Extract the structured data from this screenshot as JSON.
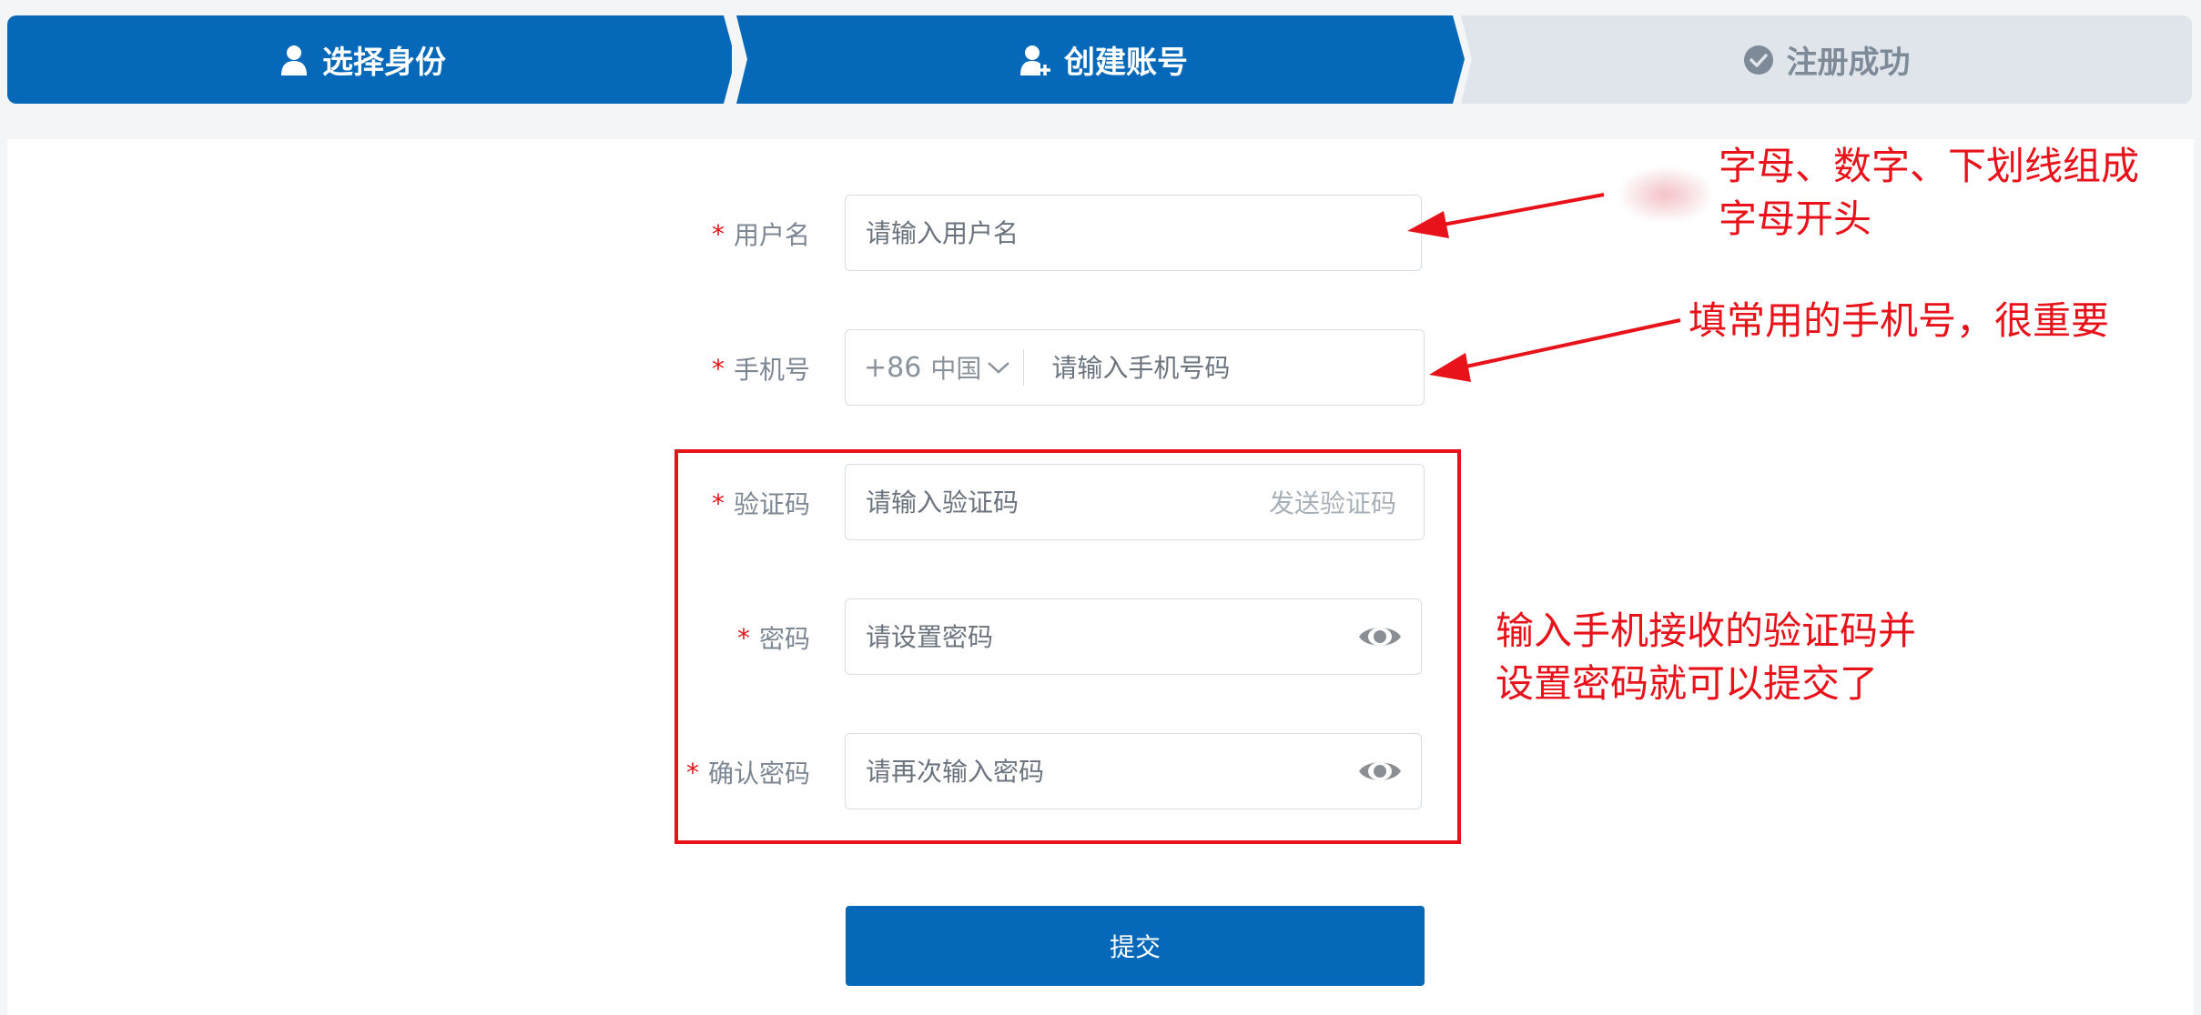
{
  "steps": [
    {
      "label": "选择身份",
      "icon": "user-icon",
      "active": true
    },
    {
      "label": "创建账号",
      "icon": "user-add-icon",
      "active": true
    },
    {
      "label": "注册成功",
      "icon": "check-circle-icon",
      "active": false
    }
  ],
  "form": {
    "username": {
      "label": "用户名",
      "required_mark": "*",
      "placeholder": "请输入用户名"
    },
    "phone": {
      "label": "手机号",
      "required_mark": "*",
      "country_code": "+86",
      "country_name": "中国",
      "placeholder": "请输入手机号码"
    },
    "code": {
      "label": "验证码",
      "required_mark": "*",
      "placeholder": "请输入验证码",
      "send_label": "发送验证码"
    },
    "password": {
      "label": "密码",
      "required_mark": "*",
      "placeholder": "请设置密码",
      "toggle_icon": "eye-icon"
    },
    "confirm": {
      "label": "确认密码",
      "required_mark": "*",
      "placeholder": "请再次输入密码",
      "toggle_icon": "eye-icon"
    },
    "submit_label": "提交"
  },
  "annotations": {
    "username_note_line1": "字母、数字、下划线组成",
    "username_note_line2": "字母开头",
    "phone_note": "填常用的手机号，很重要",
    "code_note_line1": "输入手机接收的验证码并",
    "code_note_line2": "设置密码就可以提交了"
  },
  "colors": {
    "primary": "#0568b8",
    "step_inactive_bg": "#dfe5ea",
    "required": "#e0161b",
    "annotation": "#e8121a"
  }
}
